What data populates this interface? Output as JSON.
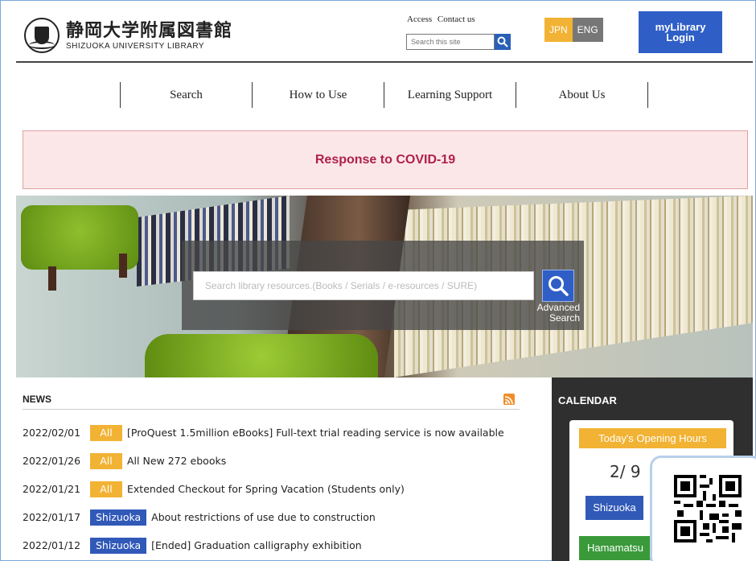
{
  "header": {
    "logo_jp": "静岡大学附属図書館",
    "logo_en": "SHIZUOKA UNIVERSITY LIBRARY",
    "links": [
      "Access",
      "Contact us"
    ],
    "site_search_placeholder": "Search this site",
    "lang_jpn": "JPN",
    "lang_eng": "ENG",
    "mylibrary_line1": "myLibrary",
    "mylibrary_line2": "Login"
  },
  "nav": {
    "items": [
      "Search",
      "How to Use",
      "Learning Support",
      "About Us"
    ]
  },
  "covid_banner": "Response to COVID-19",
  "hero": {
    "search_placeholder": "Search library resources.(Books / Serials / e-resources / SURE)",
    "advanced_line1": "Advanced",
    "advanced_line2": "Search"
  },
  "news": {
    "heading": "NEWS",
    "items": [
      {
        "date": "2022/02/01",
        "tag": "All",
        "text": "[ProQuest 1.5million eBooks] Full-text trial reading service is now available"
      },
      {
        "date": "2022/01/26",
        "tag": "All",
        "text": "All New 272 ebooks"
      },
      {
        "date": "2022/01/21",
        "tag": "All",
        "text": "Extended Checkout for Spring Vacation (Students only)"
      },
      {
        "date": "2022/01/17",
        "tag": "Shizuoka",
        "text": "About restrictions of use due to construction"
      },
      {
        "date": "2022/01/12",
        "tag": "Shizuoka",
        "text": "[Ended] Graduation calligraphy exhibition"
      }
    ]
  },
  "calendar": {
    "heading": "CALENDAR",
    "today_label": "Today's Opening Hours",
    "date": "2/ 9",
    "campus_shizuoka": "Shizuoka",
    "campus_hamamatsu": "Hamamatsu"
  },
  "colors": {
    "accent_yellow": "#f2b233",
    "brand_blue": "#2f5fc6",
    "covid_text": "#b0214a",
    "campus_green": "#3a9a3a"
  }
}
